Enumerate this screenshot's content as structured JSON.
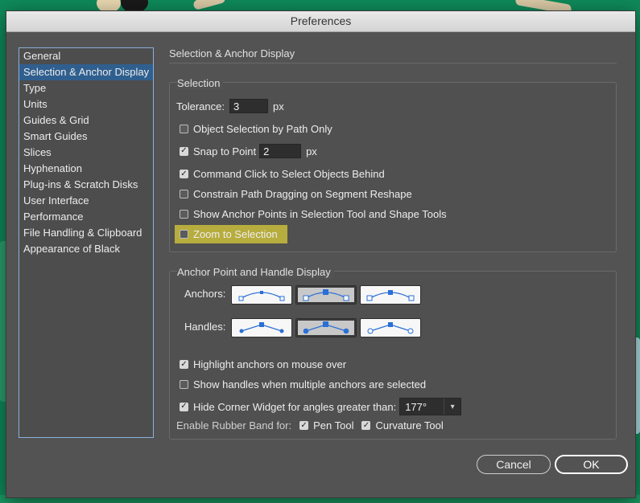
{
  "window": {
    "title": "Preferences"
  },
  "sidebar": {
    "items": [
      {
        "label": "General"
      },
      {
        "label": "Selection & Anchor Display",
        "active": true
      },
      {
        "label": "Type"
      },
      {
        "label": "Units"
      },
      {
        "label": "Guides & Grid"
      },
      {
        "label": "Smart Guides"
      },
      {
        "label": "Slices"
      },
      {
        "label": "Hyphenation"
      },
      {
        "label": "Plug-ins & Scratch Disks"
      },
      {
        "label": "User Interface"
      },
      {
        "label": "Performance"
      },
      {
        "label": "File Handling & Clipboard"
      },
      {
        "label": "Appearance of Black"
      }
    ]
  },
  "main": {
    "section_title": "Selection & Anchor Display",
    "selection": {
      "title": "Selection",
      "tolerance_label": "Tolerance:",
      "tolerance_value": "3",
      "tolerance_unit": "px",
      "object_selection_by_path_only": {
        "label": "Object Selection by Path Only",
        "checked": false
      },
      "snap_to_point": {
        "label": "Snap to Point",
        "checked": true,
        "value": "2",
        "unit": "px"
      },
      "command_click": {
        "label": "Command Click to Select Objects Behind",
        "checked": true
      },
      "constrain_path": {
        "label": "Constrain Path Dragging on Segment Reshape",
        "checked": false
      },
      "show_anchor_points": {
        "label": "Show Anchor Points in Selection Tool and Shape Tools",
        "checked": false
      },
      "zoom_to_selection": {
        "label": "Zoom to Selection",
        "checked": false,
        "highlight_color": "#b7ad3e"
      }
    },
    "anchor_display": {
      "title": "Anchor Point and Handle Display",
      "anchors_label": "Anchors:",
      "anchors_options": [
        {
          "icon": "anchor-style-small-hollow-icon"
        },
        {
          "icon": "anchor-style-large-solid-icon",
          "selected": true
        },
        {
          "icon": "anchor-style-medium-hollow-icon"
        }
      ],
      "handles_label": "Handles:",
      "handles_options": [
        {
          "icon": "handle-style-small-solid-icon"
        },
        {
          "icon": "handle-style-large-solid-icon",
          "selected": true
        },
        {
          "icon": "handle-style-hollow-icon"
        }
      ],
      "highlight_anchors": {
        "label": "Highlight anchors on mouse over",
        "checked": true
      },
      "show_handles_multiple": {
        "label": "Show handles when multiple anchors are selected",
        "checked": false
      },
      "hide_corner_widget": {
        "label": "Hide Corner Widget for angles greater than:",
        "checked": true,
        "value": "177°"
      },
      "rubber_band_label": "Enable Rubber Band for:",
      "pen_tool": {
        "label": "Pen Tool",
        "checked": true
      },
      "curvature_tool": {
        "label": "Curvature Tool",
        "checked": true
      }
    }
  },
  "buttons": {
    "cancel": "Cancel",
    "ok": "OK"
  },
  "colors": {
    "accent": "#2f5f8f",
    "dialog_bg": "#535353",
    "sidebar_border": "#8ab0d9"
  }
}
